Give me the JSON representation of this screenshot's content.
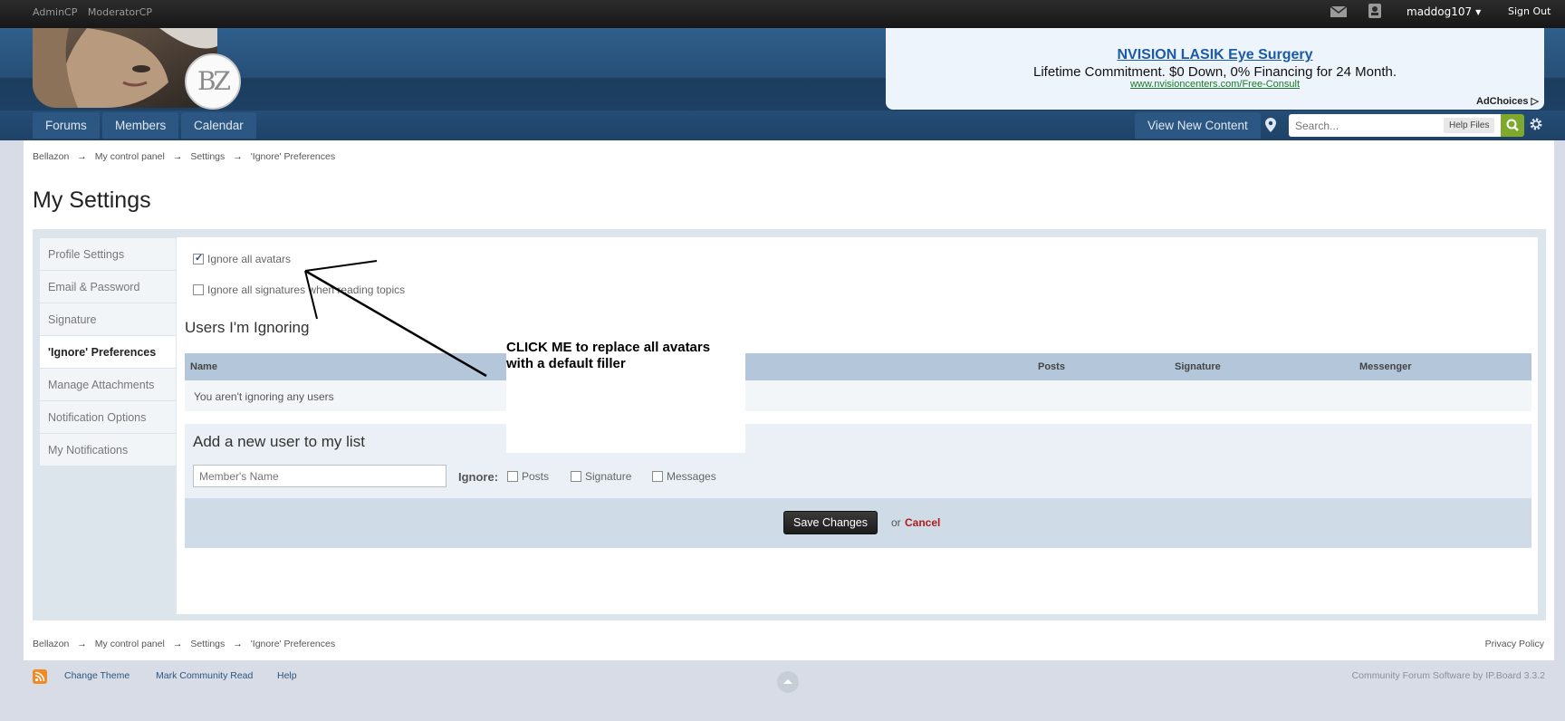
{
  "user_bar": {
    "admin_links": [
      "AdminCP",
      "ModeratorCP"
    ],
    "username": "maddog107",
    "sign_out": "Sign Out"
  },
  "ad": {
    "title": "NVISION LASIK Eye Surgery",
    "text": "Lifetime Commitment. $0 Down, 0% Financing for 24 Month.",
    "url": "www.nvisioncenters.com/Free-Consult",
    "choices": "AdChoices"
  },
  "nav": {
    "tabs": [
      "Forums",
      "Members",
      "Calendar"
    ],
    "view_new_content": "View New Content",
    "search_placeholder": "Search...",
    "help_files": "Help Files"
  },
  "breadcrumb": [
    "Bellazon",
    "My control panel",
    "Settings",
    "'Ignore' Preferences"
  ],
  "breadcrumb_separator": "→",
  "privacy_policy": "Privacy Policy",
  "page_title": "My Settings",
  "sidebar": {
    "items": [
      {
        "label": "Profile Settings"
      },
      {
        "label": "Email & Password"
      },
      {
        "label": "Signature"
      },
      {
        "label": "'Ignore' Preferences"
      },
      {
        "label": "Manage Attachments"
      },
      {
        "label": "Notification Options"
      },
      {
        "label": "My Notifications"
      }
    ],
    "active_index": 3
  },
  "options": {
    "ignore_avatars": {
      "label": "Ignore all avatars",
      "checked": true
    },
    "ignore_signatures": {
      "label": "Ignore all signatures when reading topics",
      "checked": false
    }
  },
  "ignoring": {
    "heading": "Users I'm Ignoring",
    "columns": [
      "Name",
      "Posts",
      "Signature",
      "Messenger"
    ],
    "empty_message": "You aren't ignoring any users"
  },
  "add_user": {
    "heading": "Add a new user to my list",
    "name_placeholder": "Member's Name",
    "ignore_label": "Ignore:",
    "options": [
      "Posts",
      "Signature",
      "Messages"
    ]
  },
  "form": {
    "save": "Save Changes",
    "or": "or",
    "cancel": "Cancel"
  },
  "annotation": {
    "line1": "CLICK ME to replace all avatars",
    "line2": "with a default filler"
  },
  "footer": {
    "links": [
      "Change Theme",
      "Mark Community Read",
      "Help"
    ],
    "powered_by": "Community Forum Software by IP.Board 3.3.2"
  },
  "colors": {
    "nav_bar": "#1f4267",
    "search_go": "#7ea92d",
    "cancel": "#b01c1c",
    "table_header": "#b3c6da"
  }
}
